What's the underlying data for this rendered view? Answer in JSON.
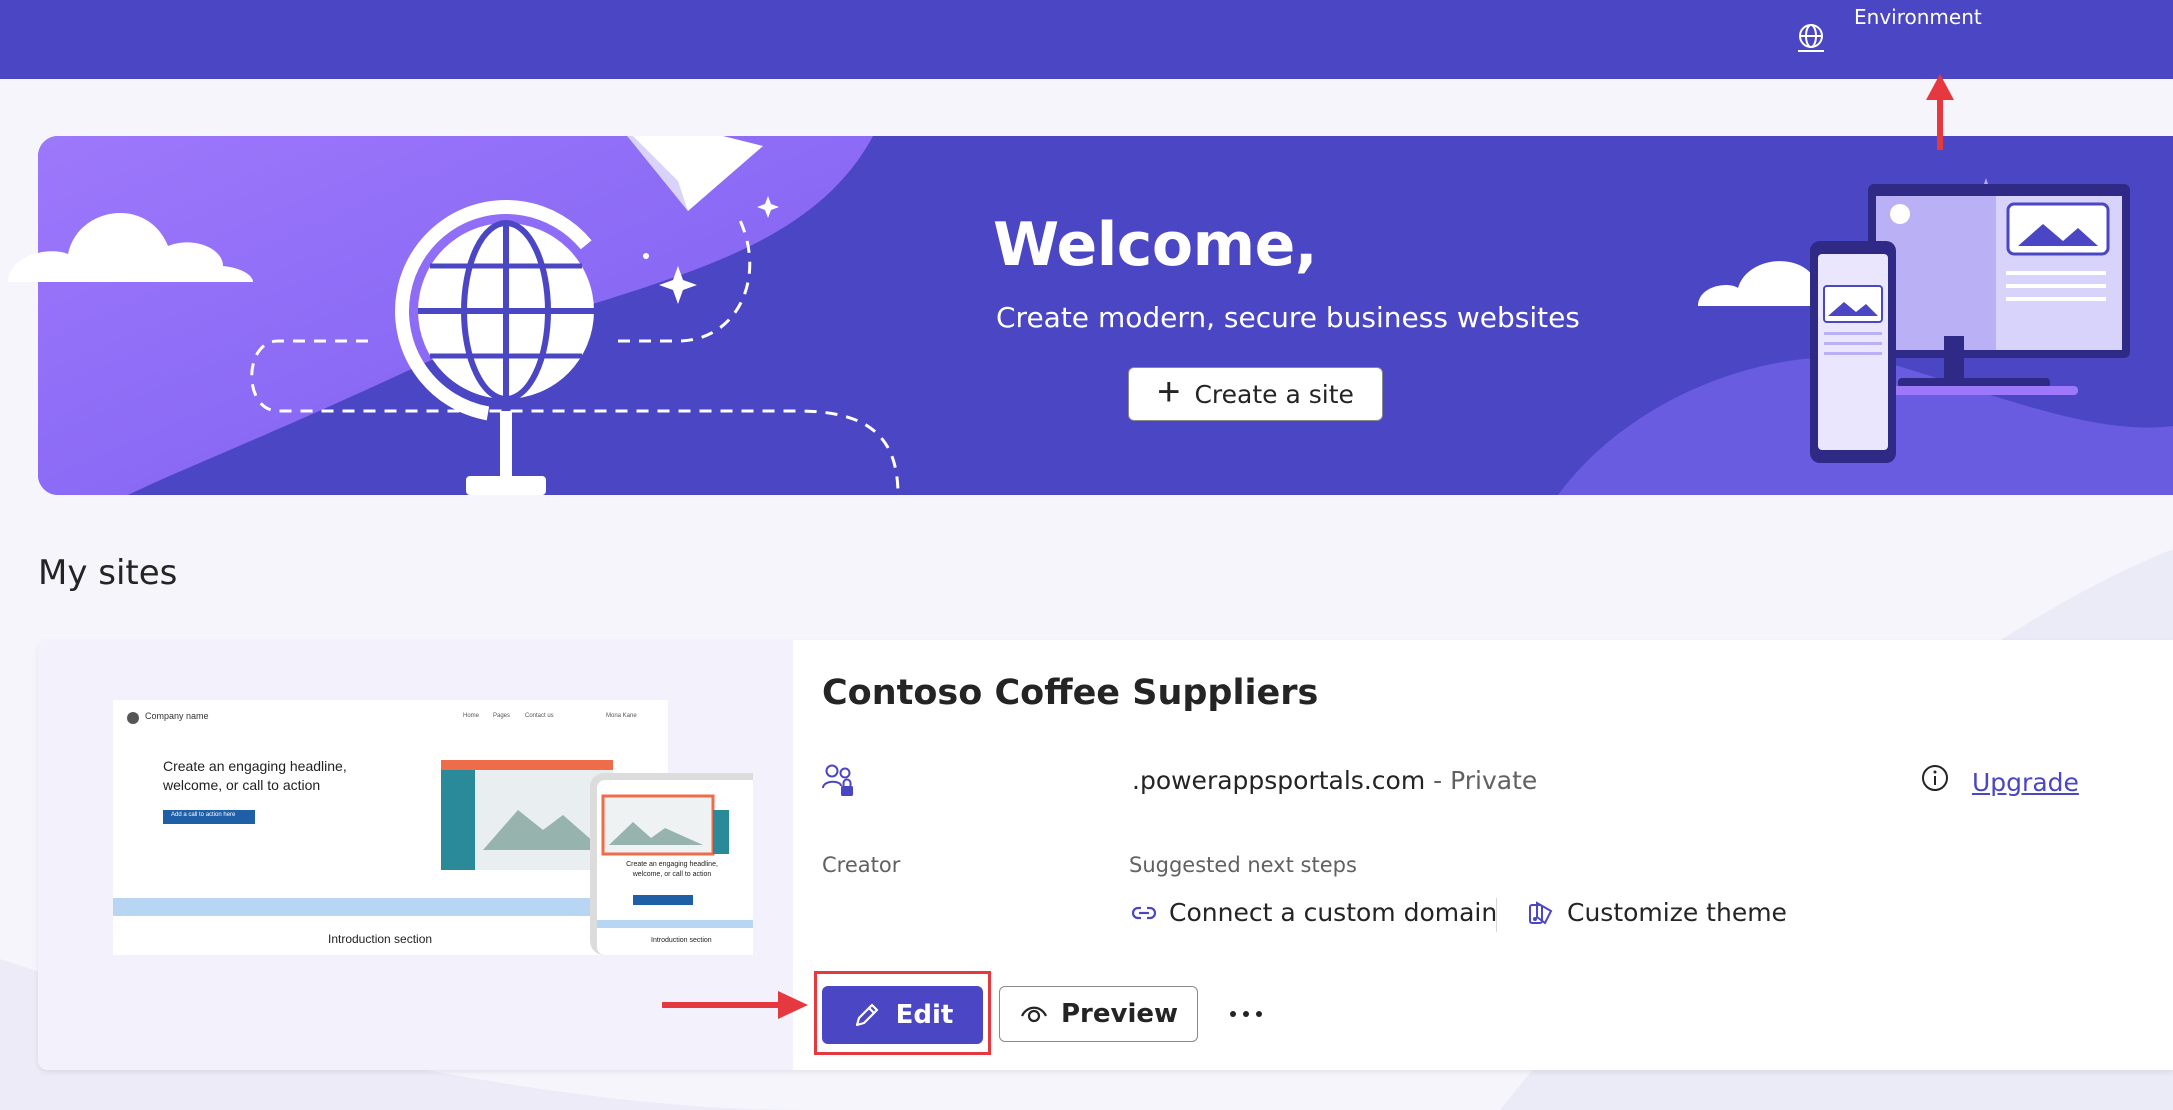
{
  "header": {
    "environment_label": "Environment",
    "environment_icon": "globe-environment-icon"
  },
  "hero": {
    "title": "Welcome,",
    "subtitle": "Create modern, secure business websites",
    "create_button": {
      "icon": "plus-icon",
      "label": "Create a site"
    }
  },
  "my_sites": {
    "heading": "My sites",
    "sites": [
      {
        "name": "Contoso Coffee Suppliers",
        "url_suffix": ".powerappsportals.com",
        "separator": " - ",
        "visibility": "Private",
        "upgrade_label": "Upgrade",
        "creator_label": "Creator",
        "next_steps_label": "Suggested next steps",
        "next_steps": [
          {
            "icon": "link-icon",
            "label": "Connect a custom domain"
          },
          {
            "icon": "paint-bucket-icon",
            "label": "Customize theme"
          }
        ],
        "actions": {
          "edit": {
            "icon": "pencil-icon",
            "label": "Edit"
          },
          "preview": {
            "icon": "eye-icon",
            "label": "Preview"
          },
          "more": {
            "icon": "more-horizontal-icon",
            "label": "..."
          }
        },
        "thumbnail": {
          "company_name": "Company name",
          "nav_items": [
            "Home",
            "Pages",
            "Contact us",
            "Mona Kane"
          ],
          "headline": "Create an engaging headline, welcome, or call to action",
          "cta": "Add a call to action here",
          "intro": "Introduction section",
          "mobile_headline": "Create an engaging headline, welcome, or call to action",
          "mobile_intro": "Introduction section"
        }
      }
    ]
  },
  "colors": {
    "brand": "#4b46c3",
    "hero_light": "#8b6cf6",
    "annotation_red": "#e5393f",
    "link": "#4b46c3"
  }
}
